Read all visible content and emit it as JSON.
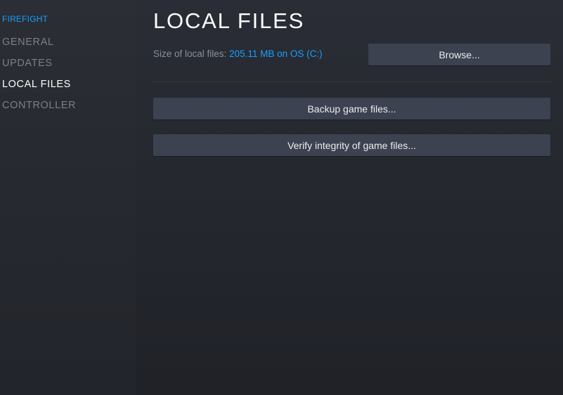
{
  "sidebar": {
    "game_title": "FIREFIGHT",
    "items": [
      {
        "label": "GENERAL"
      },
      {
        "label": "UPDATES"
      },
      {
        "label": "LOCAL FILES"
      },
      {
        "label": "CONTROLLER"
      }
    ]
  },
  "main": {
    "title": "LOCAL FILES",
    "size_label": "Size of local files:",
    "size_value": "205.11 MB on OS (C:)",
    "browse_label": "Browse...",
    "backup_label": "Backup game files...",
    "verify_label": "Verify integrity of game files..."
  },
  "colors": {
    "accent": "#1a9fff",
    "button_bg": "#3d4250",
    "sidebar_inactive": "#7c8086",
    "background": "#23262e"
  }
}
